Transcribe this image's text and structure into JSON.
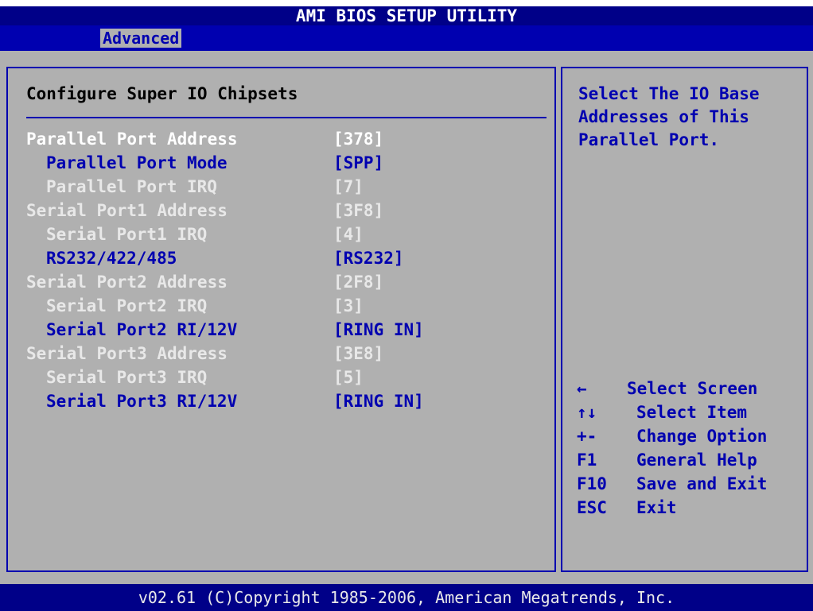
{
  "window_title": "AMI BIOS SETUP UTILITY",
  "tabs": [
    {
      "label": "Advanced",
      "active": true
    }
  ],
  "main": {
    "section_title": "Configure Super IO Chipsets",
    "settings": [
      {
        "label": "Parallel Port Address",
        "value": "[378]",
        "state": "selected"
      },
      {
        "label": "Parallel Port Mode",
        "value": "[SPP]",
        "state": "editable"
      },
      {
        "label": "Parallel Port IRQ",
        "value": "[7]",
        "state": "normal"
      },
      {
        "label": "Serial Port1 Address",
        "value": "[3F8]",
        "state": "normal"
      },
      {
        "label": "Serial Port1 IRQ",
        "value": "[4]",
        "state": "normal"
      },
      {
        "label": "RS232/422/485",
        "value": "[RS232]",
        "state": "editable"
      },
      {
        "label": "Serial Port2 Address",
        "value": "[2F8]",
        "state": "normal"
      },
      {
        "label": "Serial Port2 IRQ",
        "value": "[3]",
        "state": "normal"
      },
      {
        "label": "Serial Port2 RI/12V",
        "value": "[RING IN]",
        "state": "editable"
      },
      {
        "label": "Serial Port3 Address",
        "value": "[3E8]",
        "state": "normal"
      },
      {
        "label": "Serial Port3 IRQ",
        "value": "[5]",
        "state": "normal"
      },
      {
        "label": "Serial Port3 RI/12V",
        "value": "[RING IN]",
        "state": "editable"
      }
    ]
  },
  "help": {
    "text": "Select The IO Base Addresses of This Parallel Port.",
    "keys": [
      {
        "key": "←",
        "desc": "Select Screen"
      },
      {
        "key": "↑↓",
        "desc": "Select Item"
      },
      {
        "key": "+-",
        "desc": "Change Option"
      },
      {
        "key": "F1",
        "desc": "General Help"
      },
      {
        "key": "F10",
        "desc": "Save and Exit"
      },
      {
        "key": "ESC",
        "desc": "Exit"
      }
    ]
  },
  "footer": "v02.61 (C)Copyright 1985-2006, American Megatrends, Inc.",
  "colors": {
    "bios_blue": "#0000b0",
    "title_blue": "#000088",
    "panel_gray": "#b0b0b0",
    "selected_text": "#ffffff",
    "normal_text": "#e8e8e8"
  }
}
